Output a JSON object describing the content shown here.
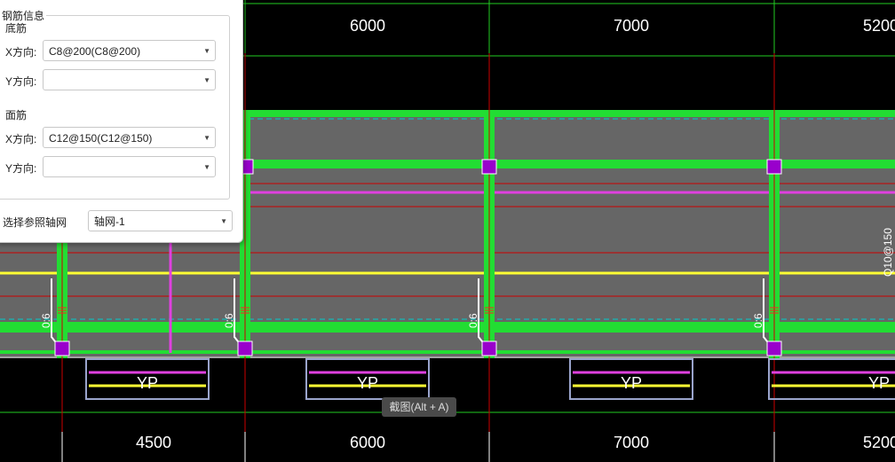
{
  "dims_top": [
    "6000",
    "7000",
    "5200"
  ],
  "dims_bottom": [
    "4500",
    "6000",
    "7000",
    "5200"
  ],
  "slope_label": "0:6",
  "beam_label": "YP",
  "rebar_side_label": "Q10@150",
  "panel": {
    "group_title": "钢筋信息",
    "bottom_title": "底筋",
    "top_title": "面筋",
    "x_label": "X方向:",
    "y_label": "Y方向:",
    "bottom_x_value": "C8@200(C8@200)",
    "bottom_y_value": "",
    "top_x_value": "C12@150(C12@150)",
    "top_y_value": "",
    "axis_label": "选择参照轴网",
    "axis_value": "轴网-1"
  },
  "tooltip": "截图(Alt + A)",
  "colors": {
    "slab": "#666666",
    "beam": "#22dd33",
    "column": "#9900cc",
    "magenta": "#e040e0",
    "yellow": "#ffff33",
    "red_axis": "#cc0000"
  }
}
